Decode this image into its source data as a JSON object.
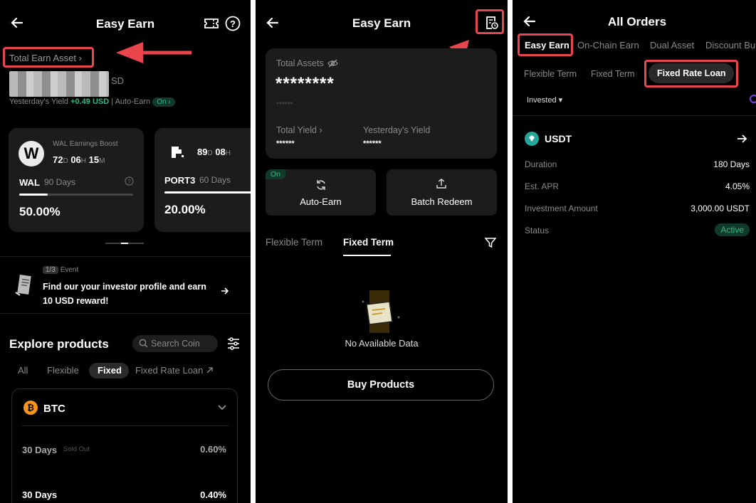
{
  "screen1": {
    "title": "Easy Earn",
    "total_earn_label": "Total Earn Asset ›",
    "currency_suffix": "SD",
    "yield_label": "Yesterday's Yield",
    "yield_value": "+0.49 USD",
    "sep": "|",
    "auto_earn_label": "Auto-Earn",
    "auto_earn_state": "On ›",
    "promo1": {
      "logo": "W",
      "name": "WAL Earnings Boost",
      "d": "72",
      "d_u": "D",
      "h": "06",
      "h_u": "H",
      "m": "15",
      "m_u": "M",
      "coin": "WAL",
      "days": "90 Days",
      "apr": "50.00%",
      "progress": 0.25
    },
    "promo2": {
      "d": "89",
      "d_u": "D",
      "h": "08",
      "h_u": "H",
      "coin": "PORT3",
      "days": "60 Days",
      "apr": "20.00%"
    },
    "event": {
      "page": "1/3",
      "label": "Event",
      "text1": "Find our your investor profile and earn",
      "text2": "10 USD reward!"
    },
    "explore_title": "Explore products",
    "search_placeholder": "Search Coin",
    "filters": [
      "All",
      "Flexible",
      "Fixed",
      "Fixed Rate Loan"
    ],
    "btc": {
      "coin": "BTC",
      "rows": [
        {
          "term": "30 Days",
          "tag": "Sold Out",
          "apr": "0.60%"
        },
        {
          "term": "30 Days",
          "tag": "",
          "apr": "0.40%"
        }
      ]
    }
  },
  "screen2": {
    "title": "Easy Earn",
    "total_assets_label": "Total Assets",
    "masked_big": "********",
    "masked_small": "******",
    "total_yield_label": "Total Yield ›",
    "yesterday_yield_label": "Yesterday's Yield",
    "total_yield_value": "******",
    "yesterday_yield_value": "******",
    "on_badge": "On",
    "auto_earn": "Auto-Earn",
    "batch_redeem": "Batch Redeem",
    "tabs": [
      "Flexible Term",
      "Fixed Term"
    ],
    "empty_text": "No Available Data",
    "buy_button": "Buy Products"
  },
  "screen3": {
    "title": "All Orders",
    "top_tabs": [
      "Easy Earn",
      "On-Chain Earn",
      "Dual Asset",
      "Discount Bu"
    ],
    "sub_tabs": [
      "Flexible Term",
      "Fixed Term",
      "Fixed Rate Loan"
    ],
    "filter_label": "Invested ▾",
    "coin": "USDT",
    "rows": [
      {
        "label": "Duration",
        "value": "180 Days"
      },
      {
        "label": "Est. APR",
        "value": "4.05%"
      },
      {
        "label": "Investment Amount",
        "value": "3,000.00 USDT"
      },
      {
        "label": "Status",
        "value": "Active"
      }
    ]
  },
  "colors": {
    "accent_green": "#2ebd85",
    "highlight_red": "#e8454c",
    "card_bg": "#1c1c1c",
    "btc_orange": "#f7931a",
    "usdt_teal": "#26a69a"
  }
}
